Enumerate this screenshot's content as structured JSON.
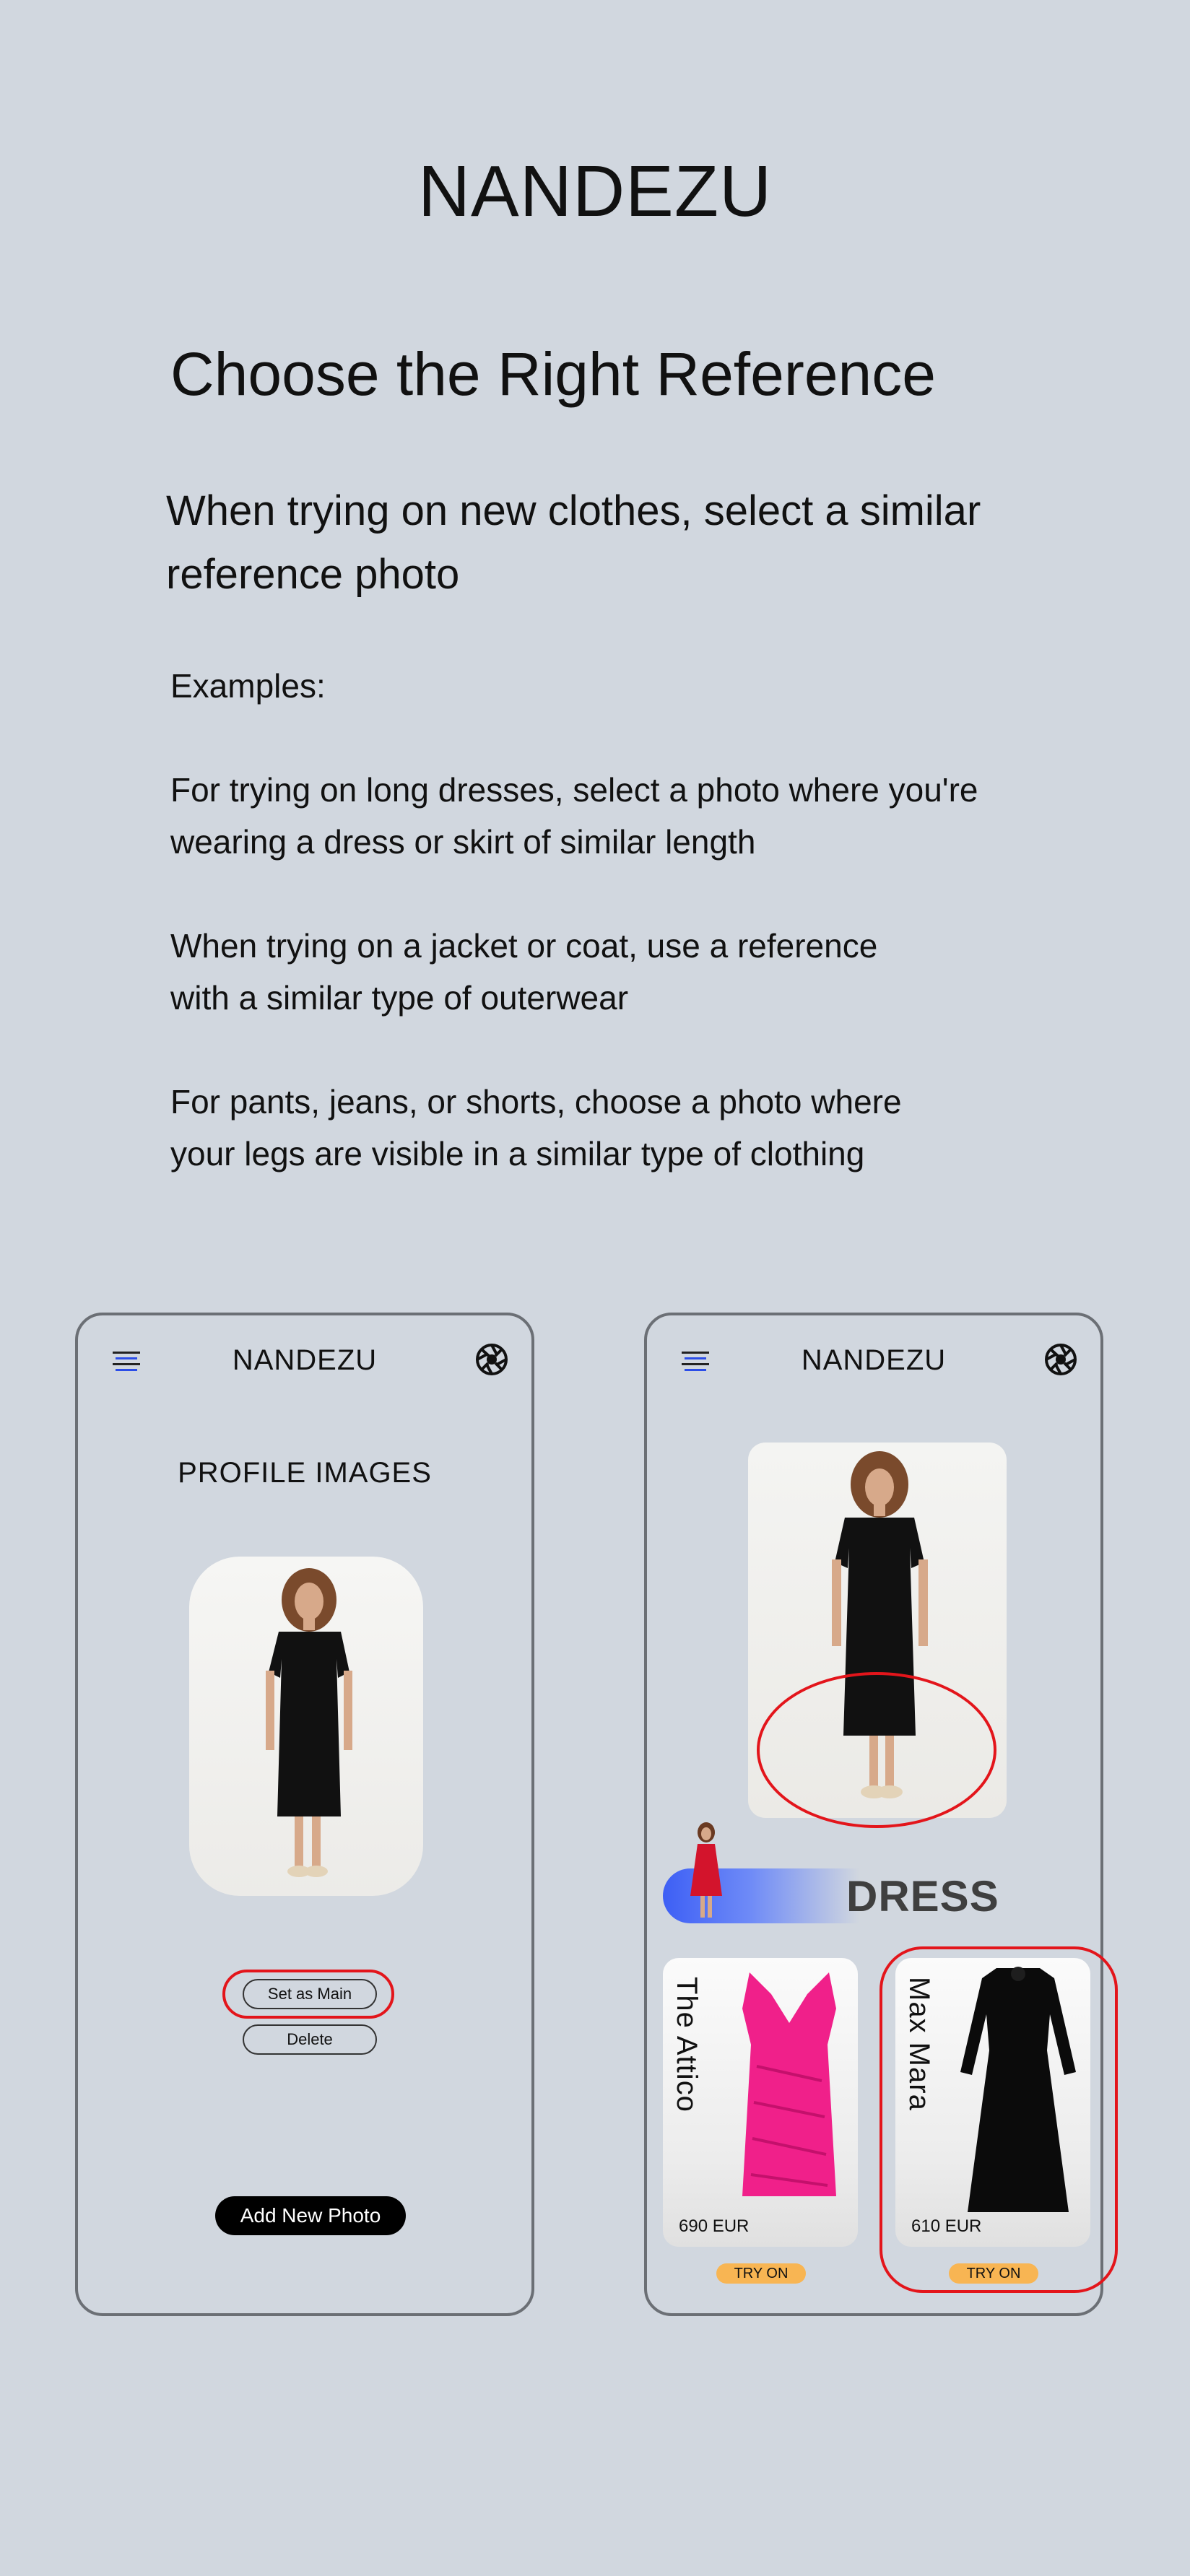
{
  "brand": "NANDEZU",
  "headline": "Choose the Right Reference",
  "subline": "When trying on new clothes, select a similar reference photo",
  "examples_label": "Examples:",
  "examples": [
    "For trying on long dresses, select a photo where you're\nwearing a dress or skirt of similar length",
    "When trying on a jacket or coat, use a reference\n with a similar type of outerwear",
    "For pants, jeans, or shorts, choose a photo where\nyour legs are visible in a similar type of clothing"
  ],
  "left_phone": {
    "brand": "NANDEZU",
    "title": "PROFILE IMAGES",
    "set_main_label": "Set as Main",
    "delete_label": "Delete",
    "add_photo_label": "Add New Photo"
  },
  "right_phone": {
    "brand": "NANDEZU",
    "category": "DRESS",
    "products": [
      {
        "brand": "The Attico",
        "price": "690 EUR",
        "cta": "TRY ON",
        "color": "#f0208a"
      },
      {
        "brand": "Max Mara",
        "price": "610 EUR",
        "cta": "TRY ON",
        "color": "#0b0b0b"
      }
    ]
  },
  "colors": {
    "background": "#d1d7df",
    "highlight": "#e3151b",
    "accent_blue": "#3d5ff5",
    "try_on": "#f8b553"
  },
  "icons": [
    "menu-icon",
    "camera-shutter-icon"
  ]
}
